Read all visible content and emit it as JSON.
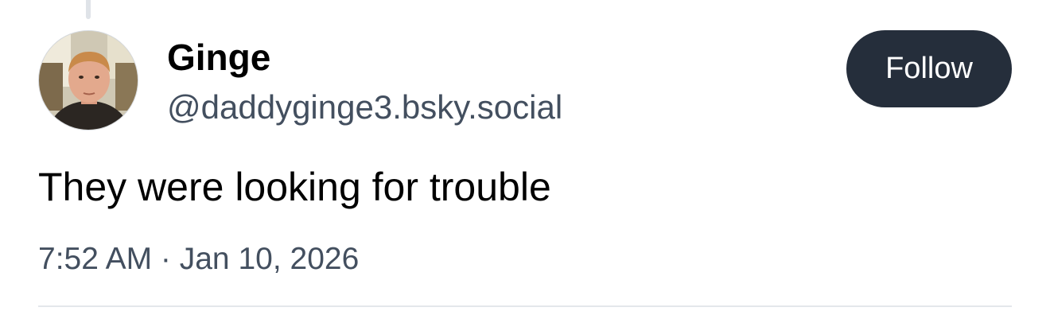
{
  "post": {
    "author": {
      "display_name": "Ginge",
      "handle": "@daddyginge3.bsky.social"
    },
    "follow_label": "Follow",
    "text": "They were looking for trouble",
    "timestamp": "7:52 AM · Jan 10, 2026"
  },
  "colors": {
    "follow_button_bg": "#252e3b",
    "secondary_text": "#434f5f",
    "primary_text": "#000000"
  }
}
